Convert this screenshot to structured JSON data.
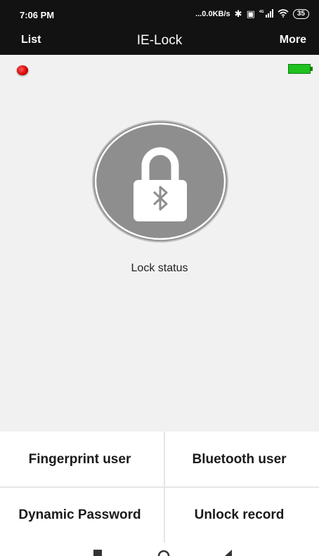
{
  "status_bar": {
    "time": "7:06 PM",
    "net_speed": "...0.0KB/s",
    "network_label": "4G",
    "battery": "35"
  },
  "nav": {
    "left": "List",
    "title": "IE-Lock",
    "right": "More"
  },
  "main": {
    "lock_status_label": "Lock status",
    "indicator_color": "#d40000",
    "device_battery_color": "#1fc11f",
    "lock_icon": "bluetooth-padlock-icon"
  },
  "buttons": {
    "fingerprint_user": "Fingerprint user",
    "bluetooth_user": "Bluetooth user",
    "dynamic_password": "Dynamic Password",
    "unlock_record": "Unlock record"
  },
  "colors": {
    "header_bg": "#121212",
    "content_bg": "#f1f1f1",
    "lock_circle": "#8e8e8e"
  }
}
